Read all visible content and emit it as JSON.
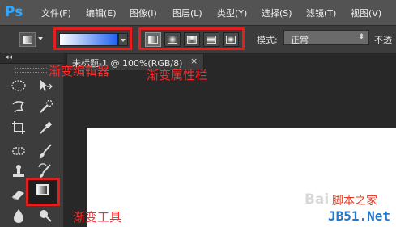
{
  "app": {
    "logo": "Ps"
  },
  "menu": [
    "文件(F)",
    "编辑(E)",
    "图像(I)",
    "图层(L)",
    "类型(Y)",
    "选择(S)",
    "滤镜(T)",
    "视图(V)"
  ],
  "options_bar": {
    "tool_preset_icon": "gradient-preset-icon",
    "gradient_colors": [
      "#ffffff",
      "#1e62f0"
    ],
    "gradient_types": [
      "linear",
      "radial",
      "angle",
      "reflected",
      "diamond"
    ],
    "selected_gradient_type": "linear",
    "mode_label": "模式:",
    "mode_value": "正常",
    "opacity_label": "不透"
  },
  "document": {
    "tab_title": "未标题-1 @ 100%(RGB/8)",
    "close_glyph": "×"
  },
  "toolbar": {
    "collapse_glyph": "◂◂",
    "tools": [
      "marquee",
      "move",
      "lasso",
      "quick-selection",
      "crop",
      "eyedropper",
      "healing-brush",
      "brush",
      "clone-stamp",
      "history-brush",
      "eraser",
      "gradient",
      "blur",
      "dodge"
    ],
    "selected_tool": "gradient"
  },
  "annotations": {
    "gradient_editor": "渐变编辑器",
    "gradient_types": "渐变属性栏",
    "gradient_tool": "渐变工具"
  },
  "watermark": {
    "baidu": "Bai",
    "jiaoben": "脚本之家",
    "jb51": "JB51.Net"
  },
  "colors": {
    "annotation_red": "#e02020",
    "ps_blue": "#31a8ff",
    "menubar_bg": "#535353",
    "panel_bg": "#3c3c3c",
    "workspace_bg": "#282828"
  }
}
